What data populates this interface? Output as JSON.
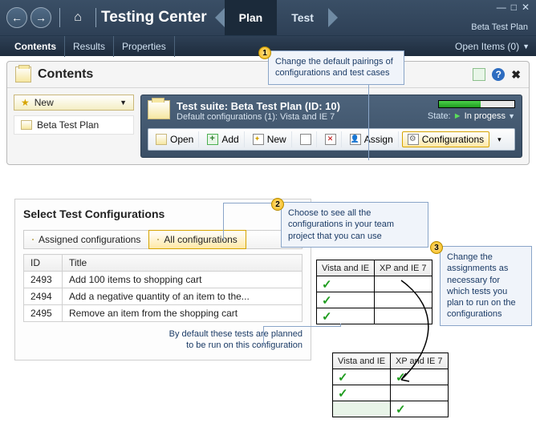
{
  "app_title": "Testing Center",
  "plan_name": "Beta Test Plan",
  "top_tabs": {
    "plan": "Plan",
    "test": "Test"
  },
  "subnav": {
    "contents": "Contents",
    "results": "Results",
    "properties": "Properties",
    "open_items": "Open Items (0)"
  },
  "panel_title": "Contents",
  "tree": {
    "new_btn": "New",
    "item": "Beta Test Plan"
  },
  "suite": {
    "title": "Test suite:  Beta Test Plan (ID: 10)",
    "subtitle": "Default configurations (1): Vista and IE 7",
    "state_label": "State:",
    "state_value": "In progess"
  },
  "toolbar": {
    "open": "Open",
    "add": "Add",
    "new": "New",
    "assign": "Assign",
    "configurations": "Configurations"
  },
  "annotations": {
    "a1": "Change the default pairings of configurations and test cases",
    "a2": "Choose to see all the configurations in your team project that you can use",
    "a3": "Change the assignments as necessary for which tests you plan to run on the configurations",
    "footnote_l1": "By default these tests are planned",
    "footnote_l2": "to be run on this configuration"
  },
  "select_panel": {
    "title": "Select Test Configurations",
    "tab_assigned": "Assigned configurations",
    "tab_all": "All configurations",
    "col_id": "ID",
    "col_title": "Title",
    "rows": [
      {
        "id": "2493",
        "title": "Add 100 items to shopping cart"
      },
      {
        "id": "2494",
        "title": "Add a negative quantity of an item to the..."
      },
      {
        "id": "2495",
        "title": "Remove an item from the shopping cart"
      }
    ]
  },
  "matrix_cols": {
    "c1": "Vista and IE",
    "c2": "XP and IE 7"
  }
}
